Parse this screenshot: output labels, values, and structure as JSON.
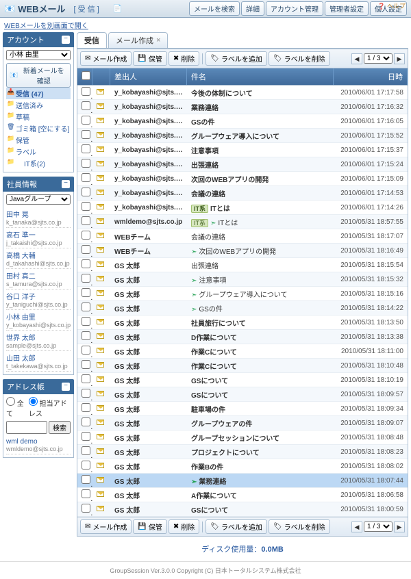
{
  "header": {
    "app_title": "WEBメール",
    "section": "[ 受 信 ]",
    "help": "ヘルプ",
    "buttons": [
      "メールを検索",
      "詳細",
      "アカウント管理",
      "管理者設定",
      "個人設定"
    ]
  },
  "sub_link": "WEBメールを別画面で開く",
  "account": {
    "title": "アカウント",
    "selected": "小林 由里",
    "new_mail_btn": "新着メールを確認",
    "folders": [
      {
        "label": "受信 (47)",
        "kind": "inbox",
        "sel": true
      },
      {
        "label": "送信済み",
        "kind": "folder"
      },
      {
        "label": "草稿",
        "kind": "folder"
      },
      {
        "label": "ゴミ箱 [空にする]",
        "kind": "trash"
      },
      {
        "label": "保管",
        "kind": "folder"
      },
      {
        "label": "ラベル",
        "kind": "folder"
      },
      {
        "label": "IT系(2)",
        "kind": "folder",
        "sub": true
      }
    ]
  },
  "staff": {
    "title": "社員情報",
    "group": "Javaグループ",
    "members": [
      {
        "name": "田中 晃",
        "email": "k_tanaka@sjts.co.jp"
      },
      {
        "name": "高石 準一",
        "email": "j_takaishi@sjts.co.jp"
      },
      {
        "name": "高橋 大輔",
        "email": "d_takahashi@sjts.co.jp"
      },
      {
        "name": "田村 真二",
        "email": "s_tamura@sjts.co.jp"
      },
      {
        "name": "谷口 洋子",
        "email": "y_taniguchi@sjts.co.jp"
      },
      {
        "name": "小林 由里",
        "email": "y_kobayashi@sjts.co.jp"
      },
      {
        "name": "世界 太郎",
        "email": "sample@sjts.co.jp"
      },
      {
        "name": "山田 太郎",
        "email": "t_takekawa@sjts.co.jp"
      }
    ]
  },
  "address": {
    "title": "アドレス帳",
    "opt_all": "全て",
    "opt_assigned": "担当アドレス",
    "search_btn": "検索",
    "entries": [
      {
        "name": "wml demo",
        "email": "wmldemo@sjts.co.jp"
      }
    ]
  },
  "tabs": [
    {
      "label": "受信",
      "active": true,
      "closable": false
    },
    {
      "label": "メール作成",
      "active": false,
      "closable": true
    }
  ],
  "toolbar": {
    "compose": "メール作成",
    "store": "保管",
    "delete": "削除",
    "add_label": "ラベルを追加",
    "del_label": "ラベルを削除"
  },
  "pager": {
    "current": "1 / 3"
  },
  "columns": {
    "from": "差出人",
    "subject": "件名",
    "date": "日時"
  },
  "mails": [
    {
      "from": "y_kobayashi@sjts.co.jp",
      "subj": "今後の体制について",
      "date": "2010/06/01 17:17:58",
      "b": true
    },
    {
      "from": "y_kobayashi@sjts.co.jp",
      "subj": "業務連絡",
      "date": "2010/06/01 17:16:32",
      "b": true
    },
    {
      "from": "y_kobayashi@sjts.co.jp",
      "subj": "GSの件",
      "date": "2010/06/01 17:16:05",
      "b": true
    },
    {
      "from": "y_kobayashi@sjts.co.jp",
      "subj": "グループウェア導入について",
      "date": "2010/06/01 17:15:52",
      "b": true
    },
    {
      "from": "y_kobayashi@sjts.co.jp",
      "subj": "注意事項",
      "date": "2010/06/01 17:15:37",
      "b": true
    },
    {
      "from": "y_kobayashi@sjts.co.jp",
      "subj": "出張連絡",
      "date": "2010/06/01 17:15:24",
      "b": true
    },
    {
      "from": "y_kobayashi@sjts.co.jp",
      "subj": "次回のWEBアプリの開発",
      "date": "2010/06/01 17:15:09",
      "b": true
    },
    {
      "from": "y_kobayashi@sjts.co.jp",
      "subj": "会議の連絡",
      "date": "2010/06/01 17:14:53",
      "b": true
    },
    {
      "from": "y_kobayashi@sjts.co.jp",
      "subj": "ITとは",
      "date": "2010/06/01 17:14:26",
      "b": true,
      "lbl": "IT系"
    },
    {
      "from": "wmldemo@sjts.co.jp",
      "subj": "ITとは",
      "date": "2010/05/31 18:57:55",
      "lbl": "IT系",
      "fwd": true
    },
    {
      "from": "WEBチーム",
      "subj": "会議の連絡",
      "date": "2010/05/31 18:17:07"
    },
    {
      "from": "WEBチーム",
      "subj": "次回のWEBアプリの開発",
      "date": "2010/05/31 18:16:49",
      "fwd": true
    },
    {
      "from": "GS 太郎",
      "subj": "出張連絡",
      "date": "2010/05/31 18:15:54"
    },
    {
      "from": "GS 太郎",
      "subj": "注意事項",
      "date": "2010/05/31 18:15:32",
      "fwd": true
    },
    {
      "from": "GS 太郎",
      "subj": "グループウェア導入について",
      "date": "2010/05/31 18:15:16",
      "fwd": true
    },
    {
      "from": "GS 太郎",
      "subj": "GSの件",
      "date": "2010/05/31 18:14:22",
      "fwd": true
    },
    {
      "from": "GS 太郎",
      "subj": "社員旅行について",
      "date": "2010/05/31 18:13:50",
      "b": true
    },
    {
      "from": "GS 太郎",
      "subj": "D作業について",
      "date": "2010/05/31 18:13:38",
      "b": true
    },
    {
      "from": "GS 太郎",
      "subj": "作業Cについて",
      "date": "2010/05/31 18:11:00",
      "b": true
    },
    {
      "from": "GS 太郎",
      "subj": "作業Cについて",
      "date": "2010/05/31 18:10:48",
      "b": true
    },
    {
      "from": "GS 太郎",
      "subj": "GSについて",
      "date": "2010/05/31 18:10:19",
      "b": true
    },
    {
      "from": "GS 太郎",
      "subj": "GSについて",
      "date": "2010/05/31 18:09:57",
      "b": true
    },
    {
      "from": "GS 太郎",
      "subj": "駐車場の件",
      "date": "2010/05/31 18:09:34",
      "b": true
    },
    {
      "from": "GS 太郎",
      "subj": "グループウェアの件",
      "date": "2010/05/31 18:09:07",
      "b": true
    },
    {
      "from": "GS 太郎",
      "subj": "グループセッションについて",
      "date": "2010/05/31 18:08:48",
      "b": true
    },
    {
      "from": "GS 太郎",
      "subj": "プロジェクトについて",
      "date": "2010/05/31 18:08:23",
      "b": true
    },
    {
      "from": "GS 太郎",
      "subj": "作業Bの件",
      "date": "2010/05/31 18:08:02",
      "b": true
    },
    {
      "from": "GS 太郎",
      "subj": "業務連絡",
      "date": "2010/05/31 18:07:44",
      "b": true,
      "sel": true,
      "fwd": true
    },
    {
      "from": "GS 太郎",
      "subj": "A作業について",
      "date": "2010/05/31 18:06:58",
      "b": true
    },
    {
      "from": "GS 太郎",
      "subj": "GSについて",
      "date": "2010/05/31 18:00:59",
      "b": true
    }
  ],
  "disk": {
    "label": "ディスク使用量：",
    "value": "0.0MB"
  },
  "copyright": "GroupSession Ver.3.0.0 Copyright (C) 日本トータルシステム株式会社"
}
